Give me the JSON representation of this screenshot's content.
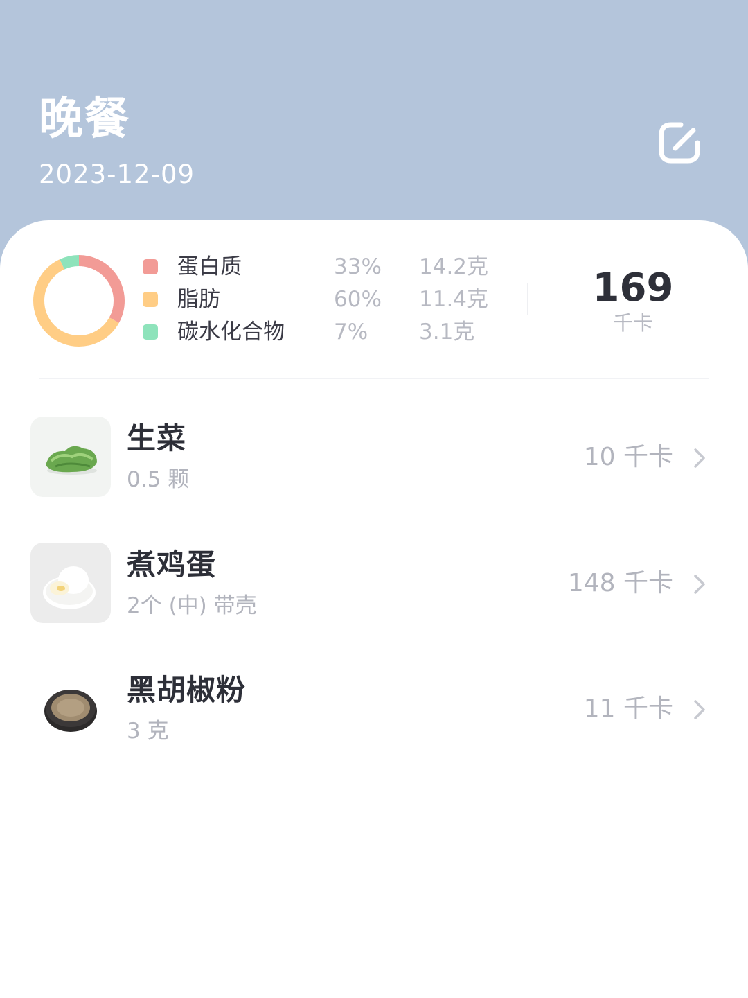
{
  "header": {
    "title": "晚餐",
    "date": "2023-12-09",
    "edit_icon": "edit-icon"
  },
  "summary": {
    "macros": [
      {
        "name": "蛋白质",
        "percent": "33%",
        "amount": "14.2克",
        "color": "#f29b96"
      },
      {
        "name": "脂肪",
        "percent": "60%",
        "amount": "11.4克",
        "color": "#ffcd85"
      },
      {
        "name": "碳水化合物",
        "percent": "7%",
        "amount": "3.1克",
        "color": "#8ee3bb"
      }
    ],
    "chart_data": {
      "type": "pie",
      "categories": [
        "蛋白质",
        "脂肪",
        "碳水化合物"
      ],
      "values": [
        33,
        60,
        7
      ]
    },
    "total_calories": "169",
    "total_unit": "千卡"
  },
  "foods": [
    {
      "name": "生菜",
      "portion": "0.5 颗",
      "calories": "10 千卡",
      "image": "lettuce"
    },
    {
      "name": "煮鸡蛋",
      "portion": "2个 (中) 带壳",
      "calories": "148 千卡",
      "image": "boiled-egg"
    },
    {
      "name": "黑胡椒粉",
      "portion": "3 克",
      "calories": "11 千卡",
      "image": "black-pepper-powder"
    }
  ],
  "colors": {
    "header_bg": "#b4c5db",
    "card_bg": "#ffffff",
    "protein": "#f29b96",
    "fat": "#ffcd85",
    "carbs": "#8ee3bb"
  }
}
